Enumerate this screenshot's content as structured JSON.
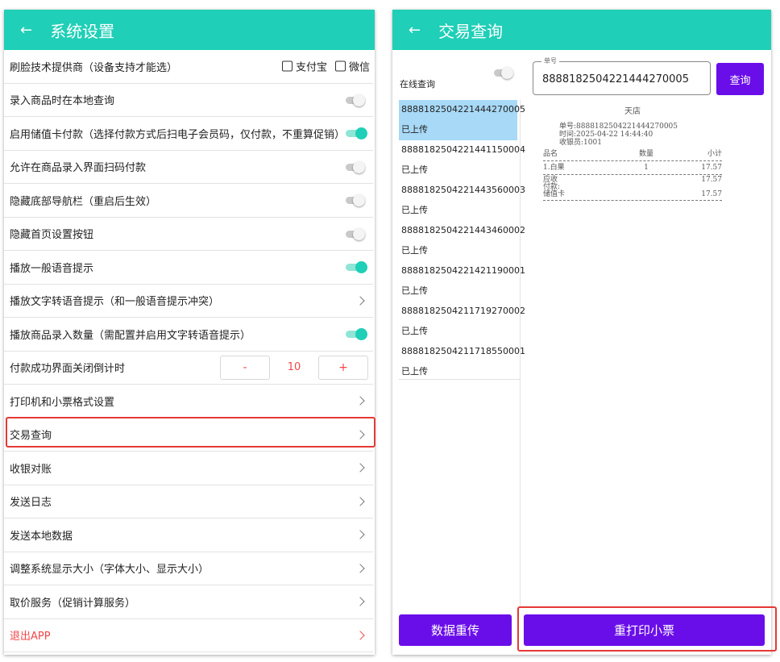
{
  "left": {
    "title": "系统设置",
    "back_icon": "←",
    "rows": [
      {
        "label": "刷脸技术提供商（设备支持才能选）",
        "control": "checks",
        "options": [
          "支付宝",
          "微信"
        ]
      },
      {
        "label": "录入商品时在本地查询",
        "control": "toggle",
        "on": false
      },
      {
        "label": "启用储值卡付款（选择付款方式后扫电子会员码，仅付款，不重算促销）",
        "control": "toggle",
        "on": true
      },
      {
        "label": "允许在商品录入界面扫码付款",
        "control": "toggle",
        "on": false
      },
      {
        "label": "隐藏底部导航栏（重启后生效）",
        "control": "toggle",
        "on": false
      },
      {
        "label": "隐藏首页设置按钮",
        "control": "toggle",
        "on": false
      },
      {
        "label": "播放一般语音提示",
        "control": "toggle",
        "on": true
      },
      {
        "label": "播放文字转语音提示（和一般语音提示冲突）",
        "control": "chevron"
      },
      {
        "label": "播放商品录入数量（需配置并启用文字转语音提示）",
        "control": "toggle",
        "on": true
      },
      {
        "label": "付款成功界面关闭倒计时",
        "control": "stepper",
        "minus": "-",
        "value": "10",
        "plus": "+"
      },
      {
        "label": "打印机和小票格式设置",
        "control": "chevron"
      },
      {
        "label": "交易查询",
        "control": "chevron"
      },
      {
        "label": "收银对账",
        "control": "chevron"
      },
      {
        "label": "发送日志",
        "control": "chevron"
      },
      {
        "label": "发送本地数据",
        "control": "chevron"
      },
      {
        "label": "调整系统显示大小（字体大小、显示大小）",
        "control": "chevron"
      },
      {
        "label": "取价服务（促销计算服务）",
        "control": "chevron"
      },
      {
        "label": "退出APP",
        "control": "chevron",
        "danger": true
      }
    ]
  },
  "right": {
    "title": "交易查询",
    "back_icon": "←",
    "online_label": "在线查询",
    "field_label": "单号",
    "field_value": "8888182504221444270005",
    "query_button": "查询",
    "transactions": [
      {
        "id": "8888182504221444270005",
        "status": "已上传",
        "selected": true
      },
      {
        "id": "8888182504221441150004",
        "status": "已上传"
      },
      {
        "id": "8888182504221443560003",
        "status": "已上传"
      },
      {
        "id": "8888182504221443460002",
        "status": "已上传"
      },
      {
        "id": "8888182504221421190001",
        "status": "已上传"
      },
      {
        "id": "8888182504211719270002",
        "status": "已上传"
      },
      {
        "id": "8888182504211718550001",
        "status": "已上传"
      }
    ],
    "receipt": {
      "shop": "天店",
      "order_line": "单号:8888182504221444270005",
      "time_line": "时间:2025-04-22 14:44:40",
      "cashier_line": "收银员:1001",
      "headers": [
        "品名",
        "数量",
        "小计"
      ],
      "items": [
        {
          "name": "1.白果",
          "qty": "1",
          "subtotal": "17.57"
        }
      ],
      "due_label": "应收",
      "due_value": "17.57",
      "paid_label": "付款:",
      "card_label": "储值卡",
      "card_value": "17.57"
    },
    "resend_button": "数据重传",
    "reprint_button": "重打印小票"
  },
  "colors": {
    "accent": "#1fcfb7",
    "primary_button": "#6a0ee9",
    "danger": "#f0484a",
    "highlight_border": "#e53935",
    "selected_row": "#a8d9f6"
  }
}
